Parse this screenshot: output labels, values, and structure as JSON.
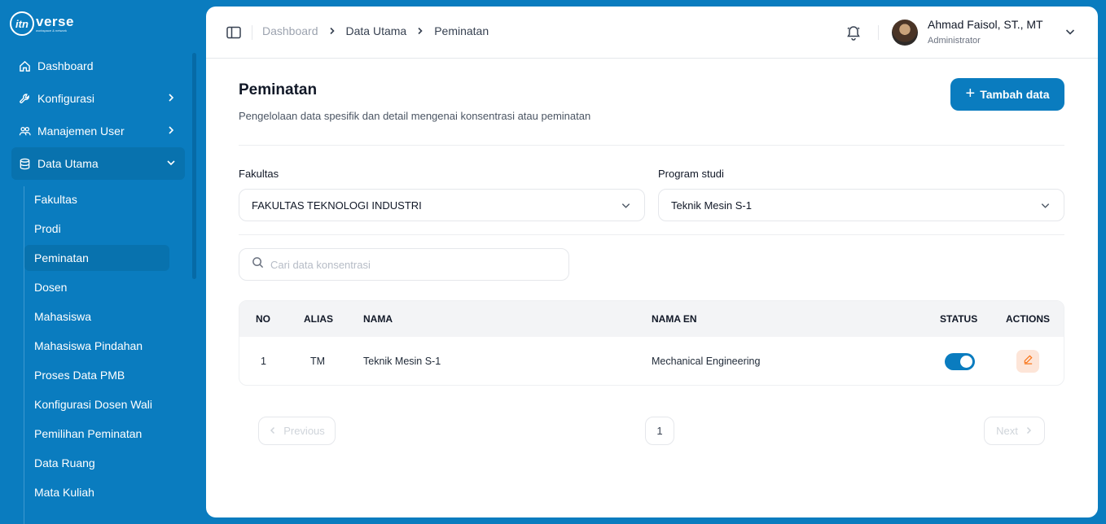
{
  "brand": {
    "mark": "itn",
    "name": "verse",
    "tagline": "workspace & network"
  },
  "sidebar": {
    "items": [
      {
        "label": "Dashboard",
        "icon": "home-icon"
      },
      {
        "label": "Konfigurasi",
        "icon": "wrench-icon"
      },
      {
        "label": "Manajemen User",
        "icon": "users-icon"
      },
      {
        "label": "Data Utama",
        "icon": "database-icon"
      }
    ],
    "subitems": [
      "Fakultas",
      "Prodi",
      "Peminatan",
      "Dosen",
      "Mahasiswa",
      "Mahasiswa Pindahan",
      "Proses Data PMB",
      "Konfigurasi Dosen Wali",
      "Pemilihan Peminatan",
      "Data Ruang",
      "Mata Kuliah"
    ],
    "active_subitem": "Peminatan"
  },
  "breadcrumb": [
    "Dashboard",
    "Data Utama",
    "Peminatan"
  ],
  "user": {
    "name": "Ahmad Faisol, ST., MT",
    "role": "Administrator"
  },
  "page": {
    "title": "Peminatan",
    "description": "Pengelolaan data spesifik dan detail mengenai konsentrasi atau peminatan",
    "add_button": "Tambah data"
  },
  "filters": {
    "fakultas": {
      "label": "Fakultas",
      "value": "FAKULTAS TEKNOLOGI INDUSTRI"
    },
    "prodi": {
      "label": "Program studi",
      "value": "Teknik Mesin S-1"
    }
  },
  "search": {
    "placeholder": "Cari data konsentrasi",
    "value": ""
  },
  "table": {
    "headers": [
      "NO",
      "ALIAS",
      "NAMA",
      "NAMA EN",
      "STATUS",
      "ACTIONS"
    ],
    "rows": [
      {
        "no": "1",
        "alias": "TM",
        "nama": "Teknik Mesin S-1",
        "nama_en": "Mechanical Engineering",
        "status": true
      }
    ]
  },
  "pagination": {
    "previous": "Previous",
    "next": "Next",
    "current": "1"
  },
  "colors": {
    "primary": "#0a7cbf",
    "edit_bg": "#fde5d8",
    "edit_icon": "#f97316"
  }
}
